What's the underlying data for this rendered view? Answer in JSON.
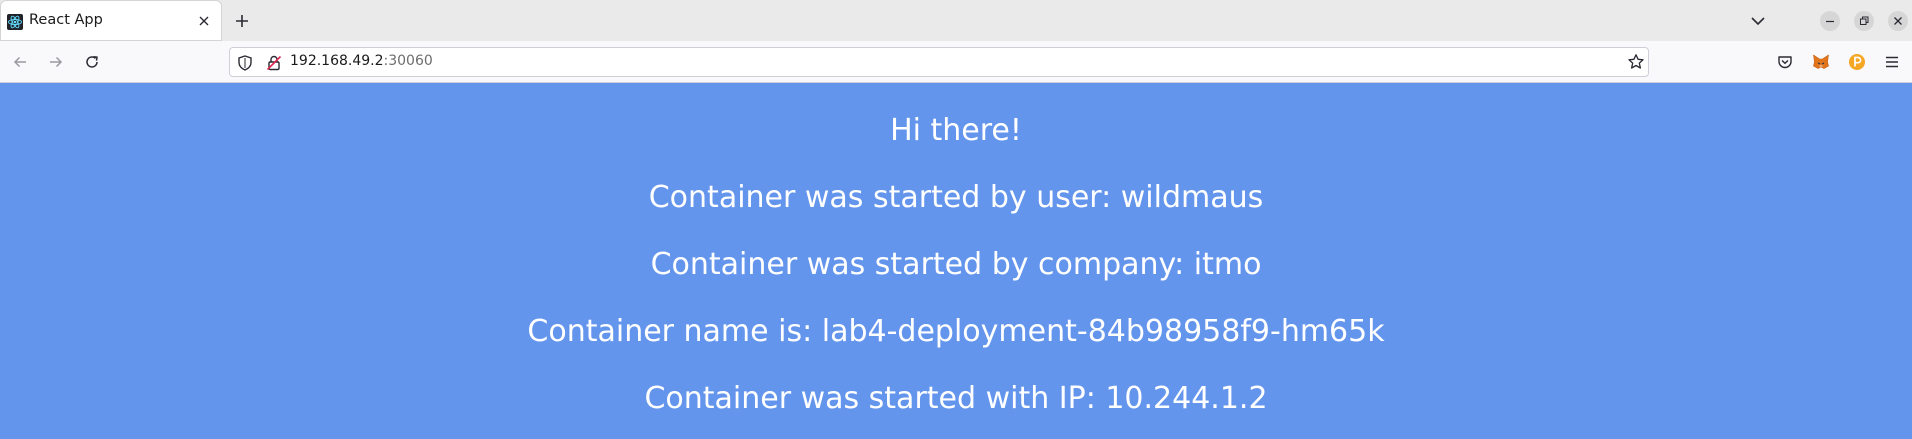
{
  "browser": {
    "tab": {
      "title": "React App",
      "favicon": "react-icon",
      "close_icon": "close-icon"
    },
    "new_tab_icon": "plus-icon",
    "tab_list_icon": "chevron-down-icon",
    "window_controls": [
      "minimize-icon",
      "restore-icon",
      "close-icon"
    ],
    "nav": {
      "back_icon": "arrow-left-icon",
      "forward_icon": "arrow-right-icon",
      "reload_icon": "reload-icon"
    },
    "url": {
      "host": "192.168.49.2",
      "port": ":30060"
    },
    "toolbar_icons": [
      "pocket-icon",
      "metamask-fox-icon",
      "extension-p-icon",
      "hamburger-menu-icon"
    ]
  },
  "page": {
    "background": "#6495ed",
    "text_color": "#ffffff",
    "lines": [
      "Hi there!",
      "Container was started by user: wildmaus",
      "Container was started by company: itmo",
      "Container name is: lab4-deployment-84b98958f9-hm65k",
      "Container was started with IP: 10.244.1.2"
    ]
  }
}
